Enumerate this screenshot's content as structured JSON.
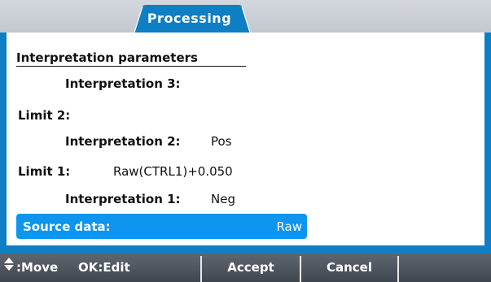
{
  "header": {
    "tab_label": "Processing"
  },
  "section": {
    "title": "Interpretation parameters"
  },
  "rows": {
    "interp3_label": "Interpretation 3:",
    "interp3_value": "",
    "limit2_label": "Limit 2:",
    "limit2_value": "",
    "interp2_label": "Interpretation 2:",
    "interp2_value": "Pos",
    "limit1_label": "Limit 1:",
    "limit1_value": "Raw(CTRL1)+0.050",
    "interp1_label": "Interpretation 1:",
    "interp1_value": "Neg",
    "source_label": "Source data:",
    "source_value": "Raw"
  },
  "footer": {
    "move_label": ":Move",
    "edit_label": "OK:Edit",
    "accept_label": "Accept",
    "cancel_label": "Cancel"
  },
  "icons": {
    "move": "up-down-arrows-icon"
  },
  "colors": {
    "accent": "#0e7fc4",
    "selection": "#0d95f0",
    "footer": "#4a5059"
  }
}
